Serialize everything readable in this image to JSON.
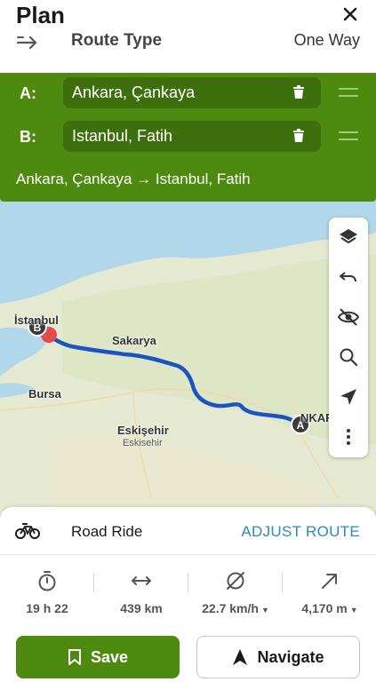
{
  "header": {
    "title": "Plan"
  },
  "route_type": {
    "label": "Route Type",
    "value": "One Way"
  },
  "waypoints": [
    {
      "label": "A:",
      "value": "Ankara, Çankaya"
    },
    {
      "label": "B:",
      "value": "Istanbul, Fatih"
    }
  ],
  "route_summary": "Ankara, Çankaya → Istanbul, Fatih",
  "map": {
    "labels": {
      "istanbul": "İstanbul",
      "istanbul_small": "Ista",
      "sakarya": "Sakarya",
      "bursa": "Bursa",
      "eskisehir": "Eskişehir",
      "eskisehir_sub": "Eskisehir",
      "ankara": "NKARA"
    },
    "markers": {
      "start": "A",
      "end": "B"
    },
    "route_color": "#1a54c4"
  },
  "map_tools": [
    "layers-icon",
    "undo-icon",
    "hide-icon",
    "search-icon",
    "locate-icon",
    "more-icon"
  ],
  "activity": {
    "label": "Road Ride",
    "action": "ADJUST ROUTE"
  },
  "stats": [
    {
      "icon": "stopwatch-icon",
      "value": "19 h 22",
      "dropdown": false
    },
    {
      "icon": "distance-icon",
      "value": "439 km",
      "dropdown": false
    },
    {
      "icon": "speed-icon",
      "value": "22.7 km/h",
      "dropdown": true
    },
    {
      "icon": "elevation-icon",
      "value": "4,170 m",
      "dropdown": true
    }
  ],
  "buttons": {
    "save": "Save",
    "navigate": "Navigate"
  },
  "colors": {
    "primary_green": "#4f8a10",
    "dark_green": "#3d6f0c",
    "link_blue": "#2a8bbd"
  }
}
